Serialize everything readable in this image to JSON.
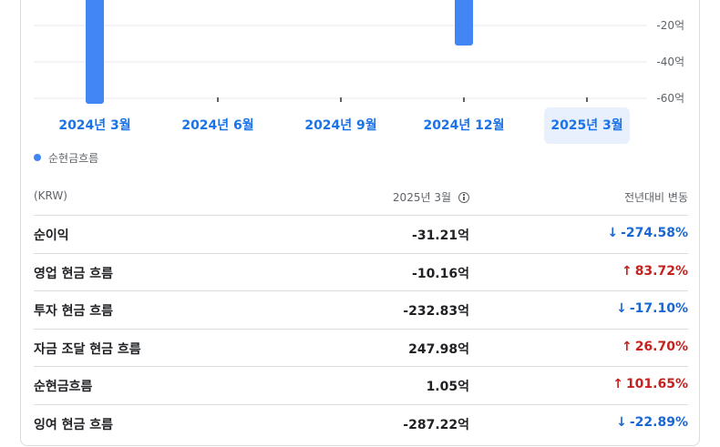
{
  "chart_data": {
    "type": "bar",
    "categories": [
      "2024년 3월",
      "2024년 6월",
      "2024년 9월",
      "2024년 12월",
      "2025년 3월"
    ],
    "values": [
      -63,
      null,
      null,
      -31,
      null
    ],
    "y_tick_labels": [
      "-20억",
      "-40억",
      "-60억"
    ],
    "y_ticks": [
      -20,
      -40,
      -60
    ],
    "ylim": [
      -65,
      0
    ],
    "grid": true,
    "selected_category": "2025년 3월",
    "bar_color": "#4285f4",
    "legend": [
      "순현금흐름"
    ]
  },
  "legend": {
    "label": "순현금흐름"
  },
  "table": {
    "headers": {
      "unit": "(KRW)",
      "period": "2025년 3월",
      "change": "전년대비 변동"
    },
    "rows": [
      {
        "name": "순이익",
        "value": "-31.21억",
        "change": "-274.58%",
        "direction": "down"
      },
      {
        "name": "영업 현금 흐름",
        "value": "-10.16억",
        "change": "83.72%",
        "direction": "up"
      },
      {
        "name": "투자 현금 흐름",
        "value": "-232.83억",
        "change": "-17.10%",
        "direction": "down"
      },
      {
        "name": "자금 조달 현금 흐름",
        "value": "247.98억",
        "change": "26.70%",
        "direction": "up"
      },
      {
        "name": "순현금흐름",
        "value": "1.05억",
        "change": "101.65%",
        "direction": "up"
      },
      {
        "name": "잉여 현금 흐름",
        "value": "-287.22억",
        "change": "-22.89%",
        "direction": "down"
      }
    ]
  },
  "colors": {
    "accent": "#1a73e8",
    "negative_change": "#1967d2",
    "positive_change": "#c5221f",
    "bar": "#4285f4"
  },
  "icons": {
    "info": "info-icon",
    "arrow_down": "arrow-down-icon",
    "arrow_up": "arrow-up-icon"
  }
}
